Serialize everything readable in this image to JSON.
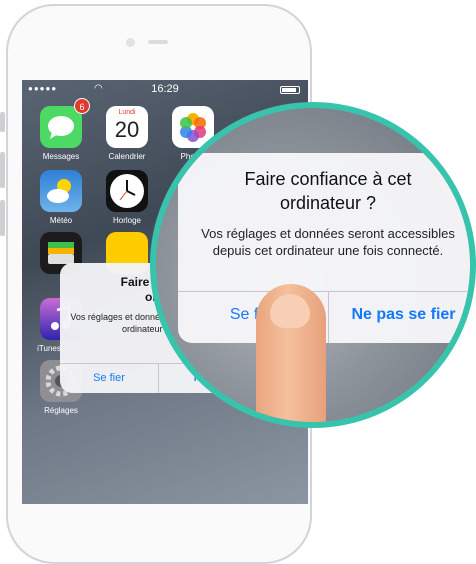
{
  "status_bar": {
    "time": "16:29"
  },
  "home_apps": [
    {
      "label": "Messages",
      "badge": "6"
    },
    {
      "label": "Calendrier",
      "day_name": "Lundi",
      "day_number": "20"
    },
    {
      "label": "Photos"
    },
    {
      "label": "Météo"
    },
    {
      "label": "Horloge"
    },
    {
      "label": "iTunes"
    },
    {
      "label": "Réglages"
    }
  ],
  "alert_small": {
    "title_line1": "Faire confiance à cet",
    "title_line2": "ordinateur ?",
    "message": "Vos réglages et données seront accessibles depuis cet ordinateur une fois connecté.",
    "btn_trust": "Se fier",
    "btn_dont_trust": "Ne pas se fier"
  },
  "alert_magnified": {
    "title_line1": "Faire confiance à cet",
    "title_line2": "ordinateur ?",
    "message": "Vos réglages et données seront accessibles depuis cet ordinateur une fois connecté.",
    "btn_trust": "Se fier",
    "btn_dont_trust": "Ne pas se fier"
  },
  "colors": {
    "accent_blue": "#1479f6",
    "magnifier_ring": "#37c3ac",
    "badge_red": "#e23a2f"
  }
}
